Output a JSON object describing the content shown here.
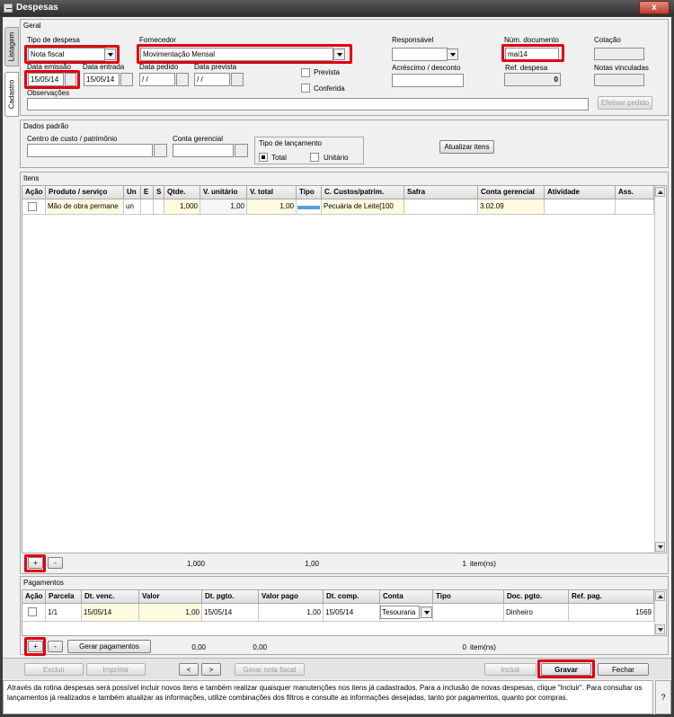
{
  "window": {
    "title": "Despesas",
    "close_glyph": "x"
  },
  "side_tabs": {
    "listagem": "Listagem",
    "cadastro": "Cadastro"
  },
  "geral": {
    "title": "Geral",
    "tipo_despesa": {
      "label": "Tipo de despesa",
      "value": "Nota fiscal"
    },
    "fornecedor": {
      "label": "Fornecedor",
      "value": "Movimentação Mensal"
    },
    "responsavel": {
      "label": "Responsável",
      "value": ""
    },
    "num_documento": {
      "label": "Núm. documento",
      "value": "mai14"
    },
    "cotacao": {
      "label": "Cotação",
      "value": ""
    },
    "data_emissao": {
      "label": "Data emissão",
      "value": "15/05/14"
    },
    "data_entrada": {
      "label": "Data entrada",
      "value": "15/05/14"
    },
    "data_pedido": {
      "label": "Data pedido",
      "value": " / /"
    },
    "data_prevista": {
      "label": "Data prevista",
      "value": " / /"
    },
    "prevista": "Prevista",
    "conferida": "Conferida",
    "acrescimo": {
      "label": "Acréscimo / desconto",
      "value": ""
    },
    "ref_despesa": {
      "label": "Ref. despesa",
      "value": "0"
    },
    "notas_vinculadas": {
      "label": "Notas vinculadas",
      "value": ""
    },
    "observacoes": {
      "label": "Observações",
      "value": ""
    },
    "efetivar_pedido": "Efetivar pedido"
  },
  "dados_padrao": {
    "title": "Dados padrão",
    "centro_custo": {
      "label": "Centro de custo / patrimônio",
      "value": ""
    },
    "conta_gerencial": {
      "label": "Conta gerencial",
      "value": ""
    },
    "tipo_lancamento": {
      "label": "Tipo de lançamento",
      "total": "Total",
      "unitario": "Unitário"
    },
    "atualizar_itens": "Atualizar itens"
  },
  "itens": {
    "title": "Itens",
    "headers": [
      "Ação",
      "Produto / serviço",
      "Un",
      "E",
      "S",
      "Qtde.",
      "V. unitário",
      "V. total",
      "Tipo",
      "C. Custos/patrim.",
      "Safra",
      "Conta gerencial",
      "Atividade",
      "Ass."
    ],
    "row": {
      "produto": "Mão de obra permane",
      "un": "un",
      "qtde": "1,000",
      "v_unitario": "1,00",
      "v_total": "1,00",
      "custos": "Pecuária de Leite[100",
      "safra": "",
      "conta": "3.02.09",
      "atividade": "",
      "ass": ""
    },
    "add": "+",
    "remove": "-",
    "total_qtde": "1,000",
    "total_valor": "1,00",
    "count": "1",
    "count_label": "item(ns)"
  },
  "pagamentos": {
    "title": "Pagamentos",
    "headers": [
      "Ação",
      "Parcela",
      "Dt. venc.",
      "Valor",
      "Dt. pgto.",
      "Valor pago",
      "Dt. comp.",
      "Conta",
      "Tipo",
      "Doc. pgto.",
      "Ref. pag."
    ],
    "row": {
      "parcela": "1/1",
      "dt_venc": "15/05/14",
      "valor": "1,00",
      "dt_pgto": "15/05/14",
      "valor_pago": "1,00",
      "dt_comp": "15/05/14",
      "conta": "Tesouraria",
      "tipo": "",
      "doc_pgto": "Dinheiro",
      "ref_pag": "1569"
    },
    "add": "+",
    "remove": "-",
    "gerar": "Gerar pagamentos",
    "total_valor": "0,00",
    "total_pago": "0,00",
    "count": "0",
    "count_label": "item(ns)"
  },
  "actions": {
    "excluir": "Excluir",
    "imprimir": "Imprimir",
    "prev": "<",
    "next": ">",
    "gerar_nota": "Gerar nota fiscal",
    "incluir": "Incluir",
    "gravar": "Gravar",
    "fechar": "Fechar"
  },
  "info": {
    "text": "Através da rotina despesas será possível incluir novos itens e também realizar quaisquer manutenções nos itens já cadastrados. Para a inclusão de novas despesas, clique \"Incluir\". Para consultar os lançamentos já realizados e também atualizar as informações, utilize combinações dos filtros e consulte as informações desejadas, tanto por pagamentos, quanto por compras.",
    "help": "?"
  },
  "colors": {
    "highlight_red": "#e00010",
    "input_yellow": "#fffbe0",
    "titlebar": "#2e2e2e"
  }
}
